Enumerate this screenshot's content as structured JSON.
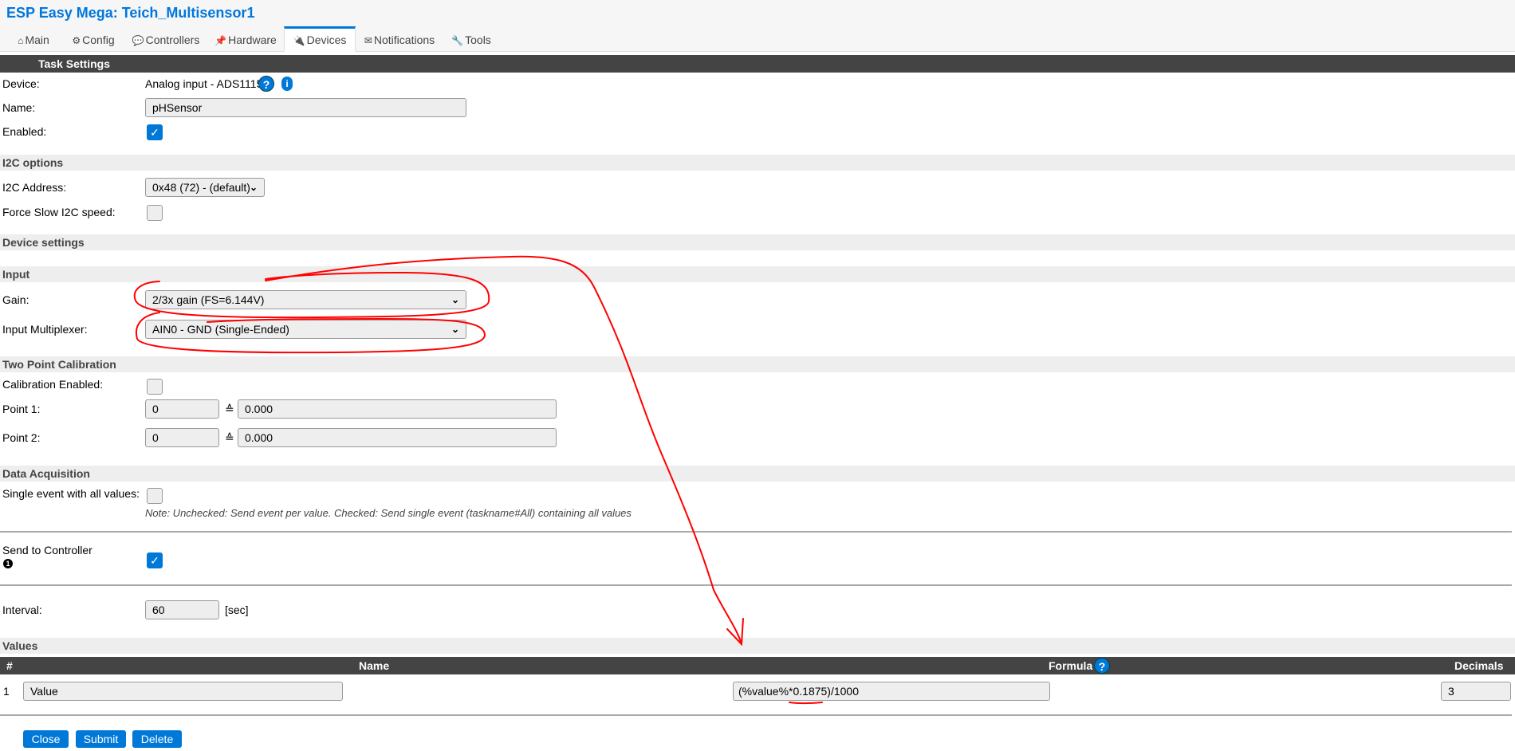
{
  "header": {
    "title": "ESP Easy Mega: Teich_Multisensor1"
  },
  "tabs": [
    {
      "label": "Main",
      "icon": "home-icon",
      "glyph": "⌂"
    },
    {
      "label": "Config",
      "icon": "gear-icon",
      "glyph": "⚙"
    },
    {
      "label": "Controllers",
      "icon": "chat-icon",
      "glyph": "💬"
    },
    {
      "label": "Hardware",
      "icon": "pin-icon",
      "glyph": "📌"
    },
    {
      "label": "Devices",
      "icon": "plug-icon",
      "glyph": "🔌",
      "active": true
    },
    {
      "label": "Notifications",
      "icon": "envelope-icon",
      "glyph": "✉"
    },
    {
      "label": "Tools",
      "icon": "wrench-icon",
      "glyph": "🔧"
    }
  ],
  "task": {
    "header": "Task Settings",
    "device_label": "Device:",
    "device_value": "Analog input - ADS1115",
    "name_label": "Name:",
    "name_value": "pHSensor",
    "enabled_label": "Enabled:",
    "enabled": true
  },
  "i2c": {
    "header": "I2C options",
    "address_label": "I2C Address:",
    "address_value": "0x48 (72) - (default)",
    "slow_label": "Force Slow I2C speed:",
    "slow": false
  },
  "device_settings": {
    "header": "Device settings"
  },
  "input": {
    "header": "Input",
    "gain_label": "Gain:",
    "gain_value": "2/3x gain (FS=6.144V)",
    "mux_label": "Input Multiplexer:",
    "mux_value": "AIN0 - GND (Single-Ended)"
  },
  "calibration": {
    "header": "Two Point Calibration",
    "enabled_label": "Calibration Enabled:",
    "enabled": false,
    "equiv_symbol": "≙",
    "points": [
      {
        "label": "Point 1:",
        "adc": "0",
        "value": "0.000"
      },
      {
        "label": "Point 2:",
        "adc": "0",
        "value": "0.000"
      }
    ]
  },
  "acquisition": {
    "header": "Data Acquisition",
    "single_event_label": "Single event with all values:",
    "single_event": false,
    "note": "Note: Unchecked: Send event per value. Checked: Send single event (taskname#All) containing all values",
    "send_label": "Send to Controller",
    "send_marker": "1",
    "send": true,
    "interval_label": "Interval:",
    "interval_value": "60",
    "interval_unit": "[sec]"
  },
  "values": {
    "header": "Values",
    "columns": {
      "num": "#",
      "name": "Name",
      "formula": "Formula",
      "decimals": "Decimals"
    },
    "rows": [
      {
        "num": "1",
        "name": "Value",
        "formula": "(%value%*0.1875)/1000",
        "decimals": "3"
      }
    ]
  },
  "buttons": {
    "close": "Close",
    "submit": "Submit",
    "delete": "Delete"
  },
  "colors": {
    "accent": "#0078d7",
    "title": "#0077dd",
    "dark_bar": "#444444",
    "band": "#eeeeee",
    "annotation": "#ff0000"
  }
}
